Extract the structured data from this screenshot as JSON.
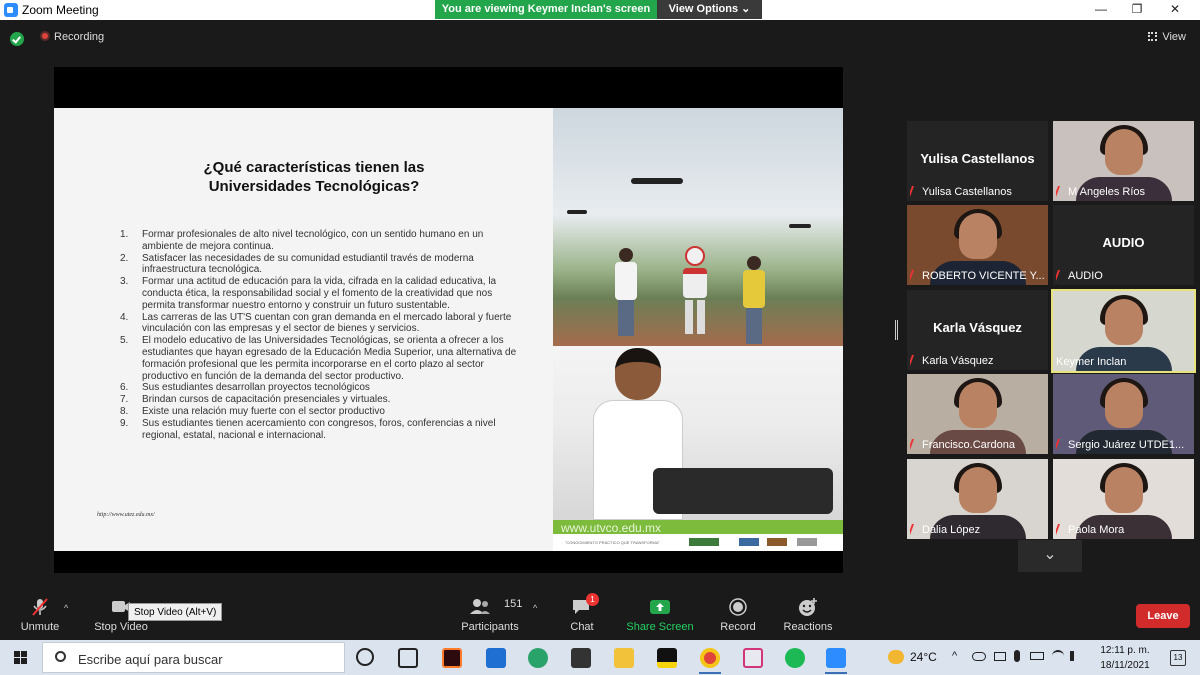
{
  "window": {
    "title": "Zoom Meeting",
    "minimize": "—",
    "restore": "❐",
    "close": "✕"
  },
  "banner": {
    "viewing": "You are viewing Keymer Inclan's screen",
    "view_options": "View Options ⌄"
  },
  "topbar": {
    "recording": "Recording",
    "view": "View"
  },
  "slide": {
    "title": "¿Qué características tienen las Universidades Tecnológicas?",
    "items": [
      {
        "num": "1.",
        "text": "Formar profesionales de alto nivel tecnológico, con un sentido humano en un ambiente de mejora continua."
      },
      {
        "num": "2.",
        "text": "Satisfacer las necesidades de su comunidad estudiantil través de moderna infraestructura tecnológica."
      },
      {
        "num": "3.",
        "text": "Formar una actitud de educación para la vida, cifrada en la calidad educativa, la conducta ética, la responsabilidad social y el fomento de la creatividad que nos permita transformar nuestro entorno y construir un futuro sustentable."
      },
      {
        "num": "4.",
        "text": "Las carreras de las UT'S cuentan con gran demanda en el mercado laboral y fuerte vinculación con las empresas y el sector de bienes y servicios."
      },
      {
        "num": "5.",
        "text": "El modelo educativo de las Universidades Tecnológicas, se orienta a ofrecer a los estudiantes que hayan egresado de la Educación Media Superior, una alternativa de formación profesional que les permita incorporarse en el corto plazo al sector productivo en función de la demanda del sector productivo."
      },
      {
        "num": "6.",
        "text": "Sus estudiantes desarrollan proyectos tecnológicos"
      },
      {
        "num": "7.",
        "text": "Brindan cursos de capacitación presenciales y virtuales."
      },
      {
        "num": "8.",
        "text": "Existe una relación muy fuerte con el sector productivo"
      },
      {
        "num": "9.",
        "text": "Sus estudiantes tienen acercamiento con congresos, foros, conferencias a nivel regional, estatal, nacional e internacional."
      }
    ],
    "source_url": "http://www.utez.edu.mx/",
    "photo_url": "www.utvco.edu.mx",
    "photo_tagline": "\"CONOCIMIENTO PRÁCTICO QUE TRANSFORMA\""
  },
  "participants_tiles": [
    {
      "label": "Yulisa Castellanos",
      "big_name": "Yulisa Castellanos",
      "video": false,
      "muted": true,
      "active": false
    },
    {
      "label": "M Angeles Ríos",
      "big_name": "",
      "video": true,
      "muted": true,
      "active": false,
      "bg": "#c9c1bd",
      "shirt": "#3a2f3a"
    },
    {
      "label": "ROBERTO VICENTE Y...",
      "big_name": "",
      "video": true,
      "muted": true,
      "active": false,
      "bg": "#7a4a2e",
      "shirt": "#1d2433"
    },
    {
      "label": "AUDIO",
      "big_name": "AUDIO",
      "video": false,
      "muted": true,
      "active": false
    },
    {
      "label": "Karla Vásquez",
      "big_name": "Karla Vásquez",
      "video": false,
      "muted": true,
      "active": false
    },
    {
      "label": "Keymer Inclan",
      "big_name": "",
      "video": true,
      "muted": false,
      "active": true,
      "bg": "#d6d8cf",
      "shirt": "#2b3a4a"
    },
    {
      "label": "Francisco.Cardona",
      "big_name": "",
      "video": true,
      "muted": true,
      "active": false,
      "bg": "#b8aea2",
      "shirt": "#6a4a44"
    },
    {
      "label": "Sergio Juárez UTDE1...",
      "big_name": "",
      "video": true,
      "muted": true,
      "active": false,
      "bg": "#5f5a78",
      "shirt": "#222831"
    },
    {
      "label": "Dalia López",
      "big_name": "",
      "video": true,
      "muted": true,
      "active": false,
      "bg": "#d8d4cf",
      "shirt": "#2e2a30"
    },
    {
      "label": "Paola Mora",
      "big_name": "",
      "video": true,
      "muted": true,
      "active": false,
      "bg": "#e2ddd9",
      "shirt": "#3b3036"
    }
  ],
  "controls": {
    "unmute": "Unmute",
    "stop_video": "Stop Video",
    "tooltip": "Stop Video (Alt+V)",
    "participants": "Participants",
    "participants_count": "151",
    "chat": "Chat",
    "chat_badge": "1",
    "share_screen": "Share Screen",
    "record": "Record",
    "reactions": "Reactions",
    "leave": "Leave"
  },
  "taskbar": {
    "search_placeholder": "Escribe aquí para buscar",
    "temperature": "24°C",
    "time": "12:11 p. m.",
    "date": "18/11/2021",
    "notifications": "13"
  },
  "colors": {
    "zoom_green": "#23a54b",
    "leave_red": "#d22b2b",
    "active_border": "#e8e27a"
  }
}
